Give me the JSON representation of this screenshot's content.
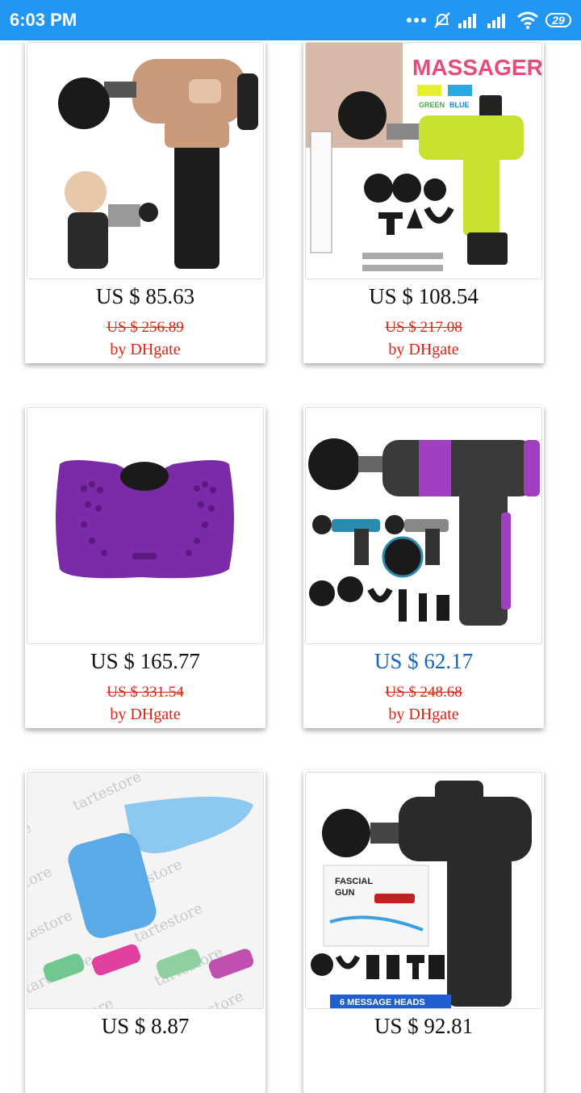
{
  "status_bar": {
    "time": "6:03 PM",
    "battery": "29"
  },
  "products": [
    {
      "price": "US $ 85.63",
      "old_price": "US $ 256.89",
      "seller": "by DHgate",
      "image": "massage-gun-rose-gold-image"
    },
    {
      "price": "US $ 108.54",
      "old_price": "US $ 217.08",
      "seller": "by DHgate",
      "image": "massager-drill-image",
      "image_text": {
        "title": "MASSAGER",
        "green": "GREEN",
        "blue": "BLUE"
      }
    },
    {
      "price": "US $ 165.77",
      "old_price": "US $ 331.54",
      "seller": "by DHgate",
      "image": "vibration-plate-image"
    },
    {
      "price": "US $ 62.17",
      "old_price": "US $ 248.68",
      "seller": "by DHgate",
      "image": "massage-gun-purple-image",
      "price_color": "#1565c0"
    },
    {
      "price": "US $ 8.87",
      "image": "derma-roller-image",
      "watermark": "tartestore"
    },
    {
      "price": "US $ 92.81",
      "image": "fascial-gun-image",
      "image_text": {
        "box_title": "FASCIAL",
        "box_sub": "GUN",
        "banner": "6 MESSAGE HEADS"
      }
    }
  ],
  "colors": {
    "status_bar": "#2196f3",
    "old_price": "#dd2211",
    "seller": "#dd2211"
  }
}
